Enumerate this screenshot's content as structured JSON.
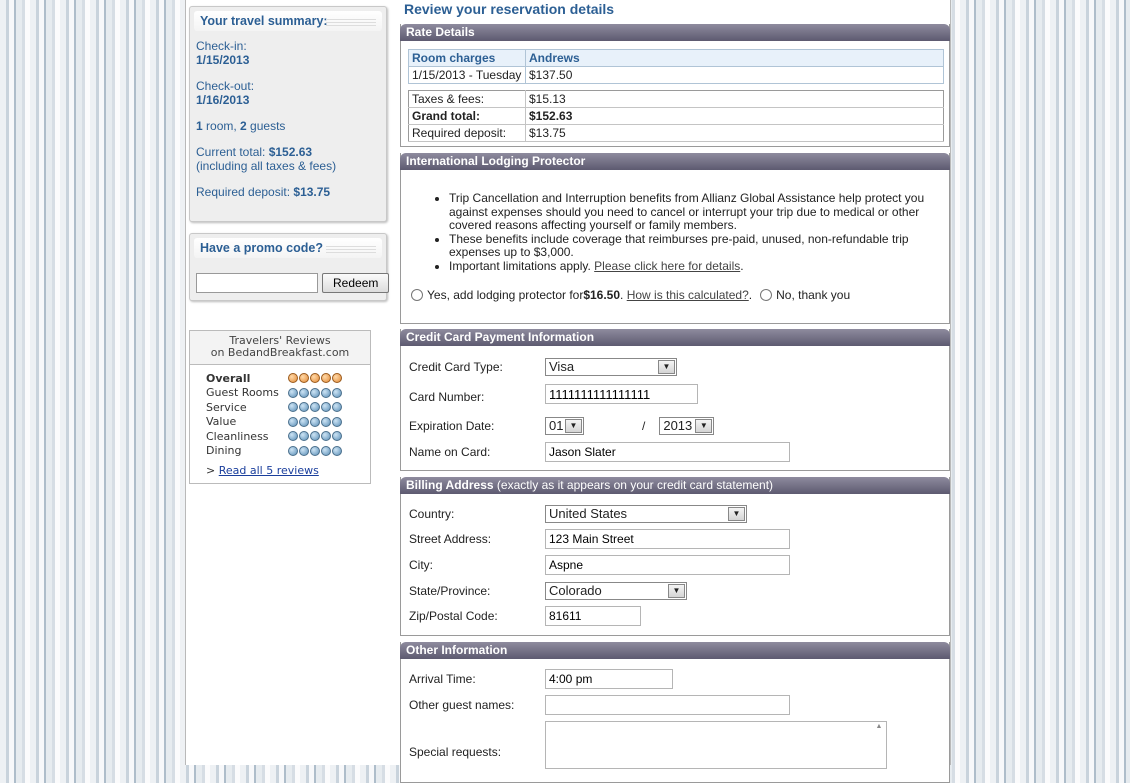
{
  "summary": {
    "title": "Your travel summary:",
    "checkin_label": "Check-in:",
    "checkin_value": "1/15/2013",
    "checkout_label": "Check-out:",
    "checkout_value": "1/16/2013",
    "rooms_count": "1",
    "rooms_text": " room, ",
    "guests_count": "2",
    "guests_text": " guests",
    "current_total_label": "Current total: ",
    "current_total_value": "$152.63",
    "taxes_note": "(including all taxes & fees)",
    "deposit_label": "Required deposit: ",
    "deposit_value": "$13.75"
  },
  "promo": {
    "title": "Have a promo code?",
    "input_value": "",
    "redeem_label": "Redeem"
  },
  "reviews": {
    "header_line1": "Travelers' Reviews",
    "header_line2": "on BedandBreakfast.com",
    "items": [
      {
        "label": "Overall",
        "rating": 5
      },
      {
        "label": "Guest Rooms",
        "rating": 5
      },
      {
        "label": "Service",
        "rating": 5
      },
      {
        "label": "Value",
        "rating": 5
      },
      {
        "label": "Cleanliness",
        "rating": 5
      },
      {
        "label": "Dining",
        "rating": 5
      }
    ],
    "link_prefix": "> ",
    "link_text": "Read all 5 reviews"
  },
  "page_title": "Review your reservation details",
  "rate": {
    "heading": "Rate Details",
    "col1": "Room charges",
    "col2": "Andrews",
    "date_row": {
      "date": "1/15/2013 - Tuesday",
      "amount": "$137.50"
    },
    "taxes_label": "Taxes & fees:",
    "taxes_value": "$15.13",
    "grand_label": "Grand total:",
    "grand_value": "$152.63",
    "deposit_label": "Required deposit:",
    "deposit_value": "$13.75"
  },
  "ilp": {
    "heading": "International Lodging Protector",
    "bullet1": "Trip Cancellation and Interruption benefits from Allianz Global Assistance help protect you against expenses should you need to cancel or interrupt your trip due to medical or other covered reasons affecting yourself or family members.",
    "bullet2": "These benefits include coverage that reimburses pre-paid, unused, non-refundable trip expenses up to $3,000.",
    "bullet3_prefix": "Important limitations apply. ",
    "bullet3_link": "Please click here for details",
    "bullet3_suffix": ".",
    "yes_prefix": "Yes, add lodging protector for ",
    "yes_price": "$16.50",
    "yes_dot": ". ",
    "calc_link": "How is this calculated?",
    "calc_after": ".",
    "no_label": "No, thank you"
  },
  "card": {
    "heading": "Credit Card Payment Information",
    "type_label": "Credit Card Type:",
    "type_value": "Visa",
    "number_label": "Card Number:",
    "number_value": "1111111111111111",
    "exp_label": "Expiration Date:",
    "exp_month": "01",
    "exp_sep": "/",
    "exp_year": "2013",
    "name_label": "Name on Card:",
    "name_value": "Jason Slater"
  },
  "billing": {
    "heading": "Billing Address",
    "heading_sub": " (exactly as it appears on your credit card statement)",
    "country_label": "Country:",
    "country_value": "United States",
    "street_label": "Street Address:",
    "street_value": "123 Main Street",
    "city_label": "City:",
    "city_value": "Aspne",
    "state_label": "State/Province:",
    "state_value": "Colorado",
    "zip_label": "Zip/Postal Code:",
    "zip_value": "81611"
  },
  "other": {
    "heading": "Other Information",
    "arrival_label": "Arrival Time:",
    "arrival_value": "4:00 pm",
    "guests_label": "Other guest names:",
    "guests_value": "",
    "requests_label": "Special requests:",
    "requests_value": ""
  }
}
